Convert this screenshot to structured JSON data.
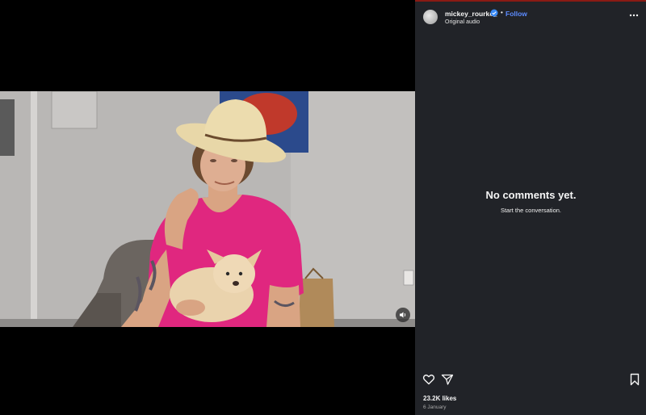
{
  "post": {
    "username": "mickey_rourke_",
    "follow_label": "Follow",
    "separator": "•",
    "audio_label": "Original audio",
    "likes": "23.2K likes",
    "date": "6 January"
  },
  "comments": {
    "empty_title": "No comments yet.",
    "empty_subtitle": "Start the conversation."
  },
  "icons": {
    "verified": "verified-badge-icon",
    "more": "more-options-icon",
    "like": "heart-icon",
    "share": "paper-plane-icon",
    "save": "bookmark-icon",
    "mute": "speaker-icon"
  },
  "colors": {
    "panel_bg": "#212328",
    "follow": "#5c8bff",
    "verified": "#3a8af5",
    "shirt": "#e0277f"
  }
}
